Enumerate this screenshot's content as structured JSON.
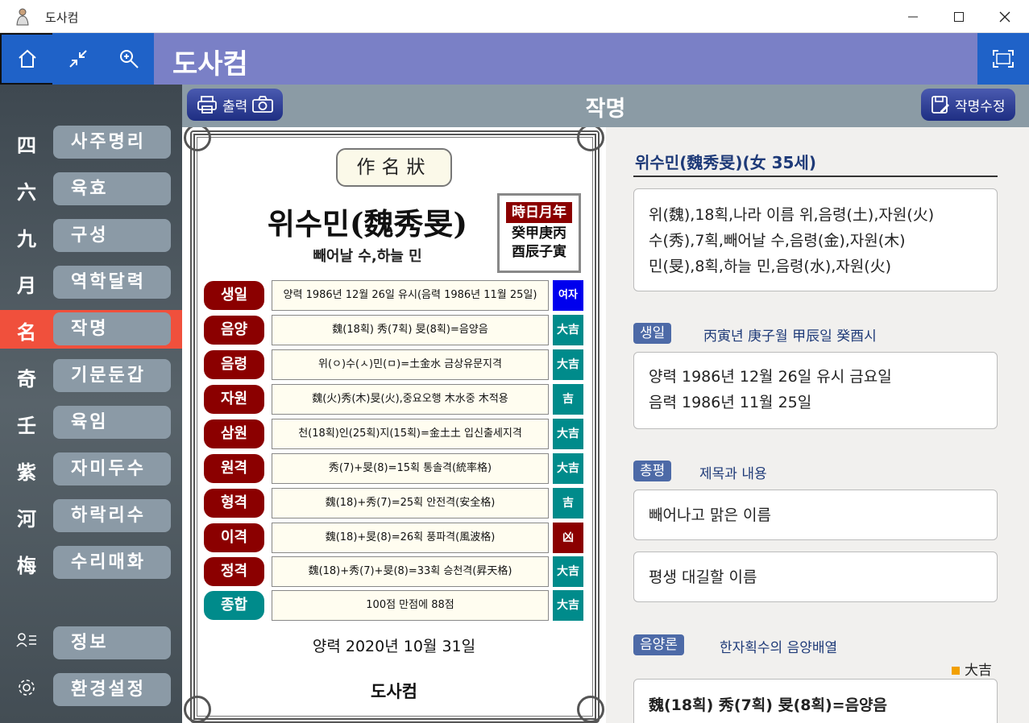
{
  "window": {
    "title": "도사컴",
    "controls": [
      "minimize-icon",
      "maximize-icon",
      "close-icon"
    ]
  },
  "header": {
    "brand": "도사컴",
    "buttons": [
      "home-icon",
      "collapse-icon",
      "zoom-icon",
      "fullscreen-icon"
    ]
  },
  "sidebar": {
    "items": [
      {
        "glyph": "四",
        "label": "사주명리"
      },
      {
        "glyph": "六",
        "label": "육효"
      },
      {
        "glyph": "九",
        "label": "구성"
      },
      {
        "glyph": "月",
        "label": "역학달력"
      },
      {
        "glyph": "名",
        "label": "작명",
        "active": true
      },
      {
        "glyph": "奇",
        "label": "기문둔갑"
      },
      {
        "glyph": "壬",
        "label": "육임"
      },
      {
        "glyph": "紫",
        "label": "자미두수"
      },
      {
        "glyph": "河",
        "label": "하락리수"
      },
      {
        "glyph": "梅",
        "label": "수리매화"
      }
    ],
    "bottom": [
      {
        "icon": "user-list-icon",
        "label": "정보"
      },
      {
        "icon": "gear-icon",
        "label": "환경설정"
      }
    ]
  },
  "subheader": {
    "title": "작명",
    "print_label": "출력",
    "edit_label": "작명수정"
  },
  "certificate": {
    "heading": "作名狀",
    "name": "위수민(魏秀旻)",
    "meaning": "빼어날 수,하늘 민",
    "pillars": {
      "header": "時日月年",
      "row1": "癸甲庚丙",
      "row2": "酉辰子寅"
    },
    "rows": [
      {
        "label": "생일",
        "value": "양력 1986년 12월 26일 유시(음력 1986년 11월 25일)",
        "badge": "여자",
        "label_color": "red",
        "badge_color": "blue"
      },
      {
        "label": "음양",
        "value": "魏(18획) 秀(7획) 旻(8획)=음양음",
        "badge": "大吉",
        "label_color": "red",
        "badge_color": "teal"
      },
      {
        "label": "음령",
        "value": "위(ㅇ)수(ㅅ)민(ㅁ)=土金水 금상유문지격",
        "badge": "大吉",
        "label_color": "red",
        "badge_color": "teal"
      },
      {
        "label": "자원",
        "value": "魏(火)秀(木)旻(火),중요오행 木水중 木적용",
        "badge": "吉",
        "label_color": "red",
        "badge_color": "teal"
      },
      {
        "label": "삼원",
        "value": "천(18획)인(25획)지(15획)=金土土 입신출세지격",
        "badge": "大吉",
        "label_color": "red",
        "badge_color": "teal"
      },
      {
        "label": "원격",
        "value": "秀(7)+旻(8)=15획 통솔격(統率格)",
        "badge": "大吉",
        "label_color": "red",
        "badge_color": "teal"
      },
      {
        "label": "형격",
        "value": "魏(18)+秀(7)=25획 안전격(安全格)",
        "badge": "吉",
        "label_color": "red",
        "badge_color": "teal"
      },
      {
        "label": "이격",
        "value": "魏(18)+旻(8)=26획 풍파격(風波格)",
        "badge": "凶",
        "label_color": "red",
        "badge_color": "red"
      },
      {
        "label": "정격",
        "value": "魏(18)+秀(7)+旻(8)=33획 승천격(昇天格)",
        "badge": "大吉",
        "label_color": "red",
        "badge_color": "teal"
      },
      {
        "label": "종합",
        "value": "100점 만점에 88점",
        "badge": "大吉",
        "label_color": "teal",
        "badge_color": "teal"
      }
    ],
    "date": "양력 2020년 10월 31일",
    "signature": "도사컴"
  },
  "detail": {
    "title": "위수민(魏秀旻)(女 35세)",
    "chars": [
      "위(魏),18획,나라 이름 위,음령(土),자원(火)",
      "수(秀),7획,빼어날 수,음령(金),자원(木)",
      "민(旻),8획,하늘 민,음령(水),자원(火)"
    ],
    "birth": {
      "tag": "생일",
      "info": "丙寅년 庚子월 甲辰일 癸酉시",
      "lines": [
        "양력 1986년 12월 26일 유시 금요일",
        "음력 1986년 11월 25일"
      ]
    },
    "summary": {
      "tag": "총평",
      "info": "제목과 내용",
      "title_text": "빼어나고 맑은 이름",
      "content_text": "평생 대길할 이름"
    },
    "yinyang": {
      "tag": "음양론",
      "info": "한자획수의 음양배열",
      "legend": "大吉",
      "content": "魏(18획) 秀(7획) 旻(8획)=음양음"
    }
  },
  "colors": {
    "header": "#7a80c6",
    "header_button": "#1f62c8",
    "active_nav": "#f0503c",
    "label_red": "#8b0000",
    "badge_teal": "#008b8b",
    "tag": "#4d6aa7"
  }
}
